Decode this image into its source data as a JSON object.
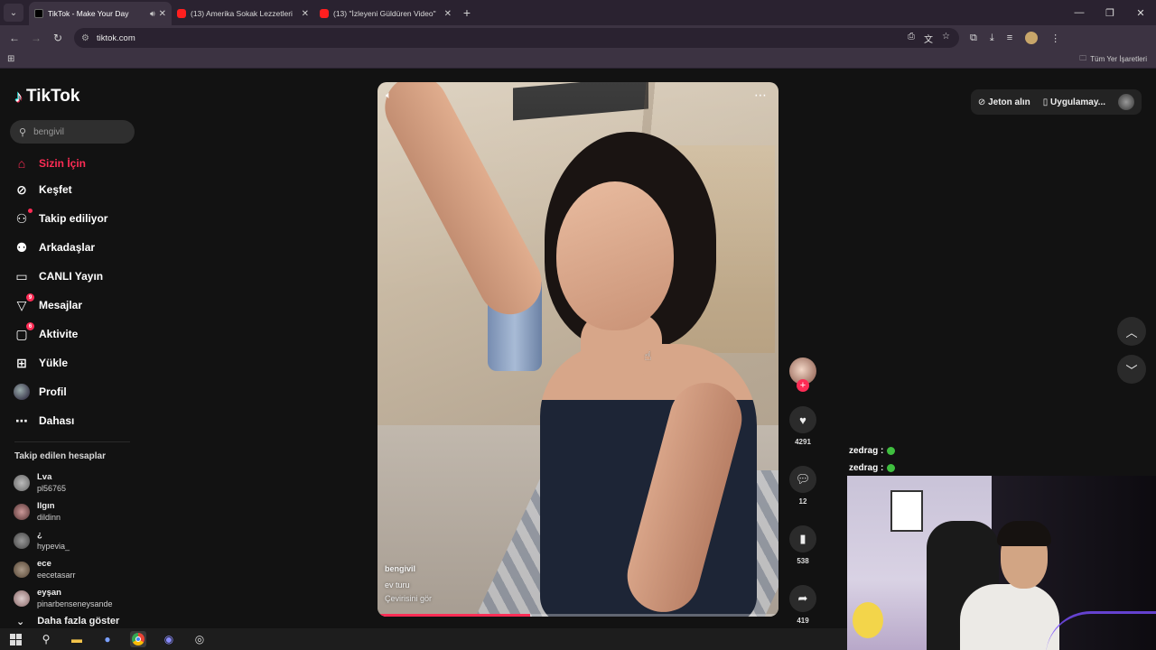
{
  "browser": {
    "tabs": [
      {
        "title": "TikTok - Make Your Day",
        "favicon": "tiktok-icon",
        "active": true,
        "audio": true
      },
      {
        "title": "(13) Amerika Sokak Lezzetleri",
        "favicon": "youtube-icon",
        "active": false
      },
      {
        "title": "(13) \"İzleyeni Güldüren Video\"",
        "favicon": "youtube-icon",
        "active": false
      }
    ],
    "url": "tiktok.com",
    "bookmarks_all": "Tüm Yer İşaretleri"
  },
  "sidebar": {
    "logo": "TikTok",
    "search_placeholder": "bengivil",
    "nav": [
      {
        "label": "Sizin İçin",
        "icon": "home-icon",
        "active": true
      },
      {
        "label": "Keşfet",
        "icon": "compass-icon"
      },
      {
        "label": "Takip ediliyor",
        "icon": "following-icon",
        "dot": true
      },
      {
        "label": "Arkadaşlar",
        "icon": "friends-icon"
      },
      {
        "label": "CANLI Yayın",
        "icon": "live-icon"
      },
      {
        "label": "Mesajlar",
        "icon": "messages-icon",
        "badge": "9"
      },
      {
        "label": "Aktivite",
        "icon": "activity-icon",
        "badge": "6"
      },
      {
        "label": "Yükle",
        "icon": "upload-icon"
      },
      {
        "label": "Profil",
        "icon": "profile-avatar"
      },
      {
        "label": "Dahası",
        "icon": "more-icon"
      }
    ],
    "following_title": "Takip edilen hesaplar",
    "following": [
      {
        "name": "Lva",
        "handle": "pl56765"
      },
      {
        "name": "Ilgın",
        "handle": "dildinn"
      },
      {
        "name": "¿",
        "handle": "hypevia_"
      },
      {
        "name": "ece",
        "handle": "eecetasarr"
      },
      {
        "name": "eyşan",
        "handle": "pinarbenseneysande"
      }
    ],
    "show_more": "Daha fazla göster"
  },
  "video": {
    "username": "bengivil",
    "caption": "ev turu",
    "translation": "Çevirisini gör",
    "progress": 0.38,
    "likes": "4291",
    "comments": "12",
    "bookmarks": "538",
    "shares": "419"
  },
  "header": {
    "coins": "Jeton alın",
    "app": "Uygulamay..."
  },
  "chat": [
    {
      "user": "zedrag :"
    },
    {
      "user": "zedrag :"
    }
  ],
  "colors": {
    "accent": "#fe2c55",
    "background": "#121212"
  }
}
